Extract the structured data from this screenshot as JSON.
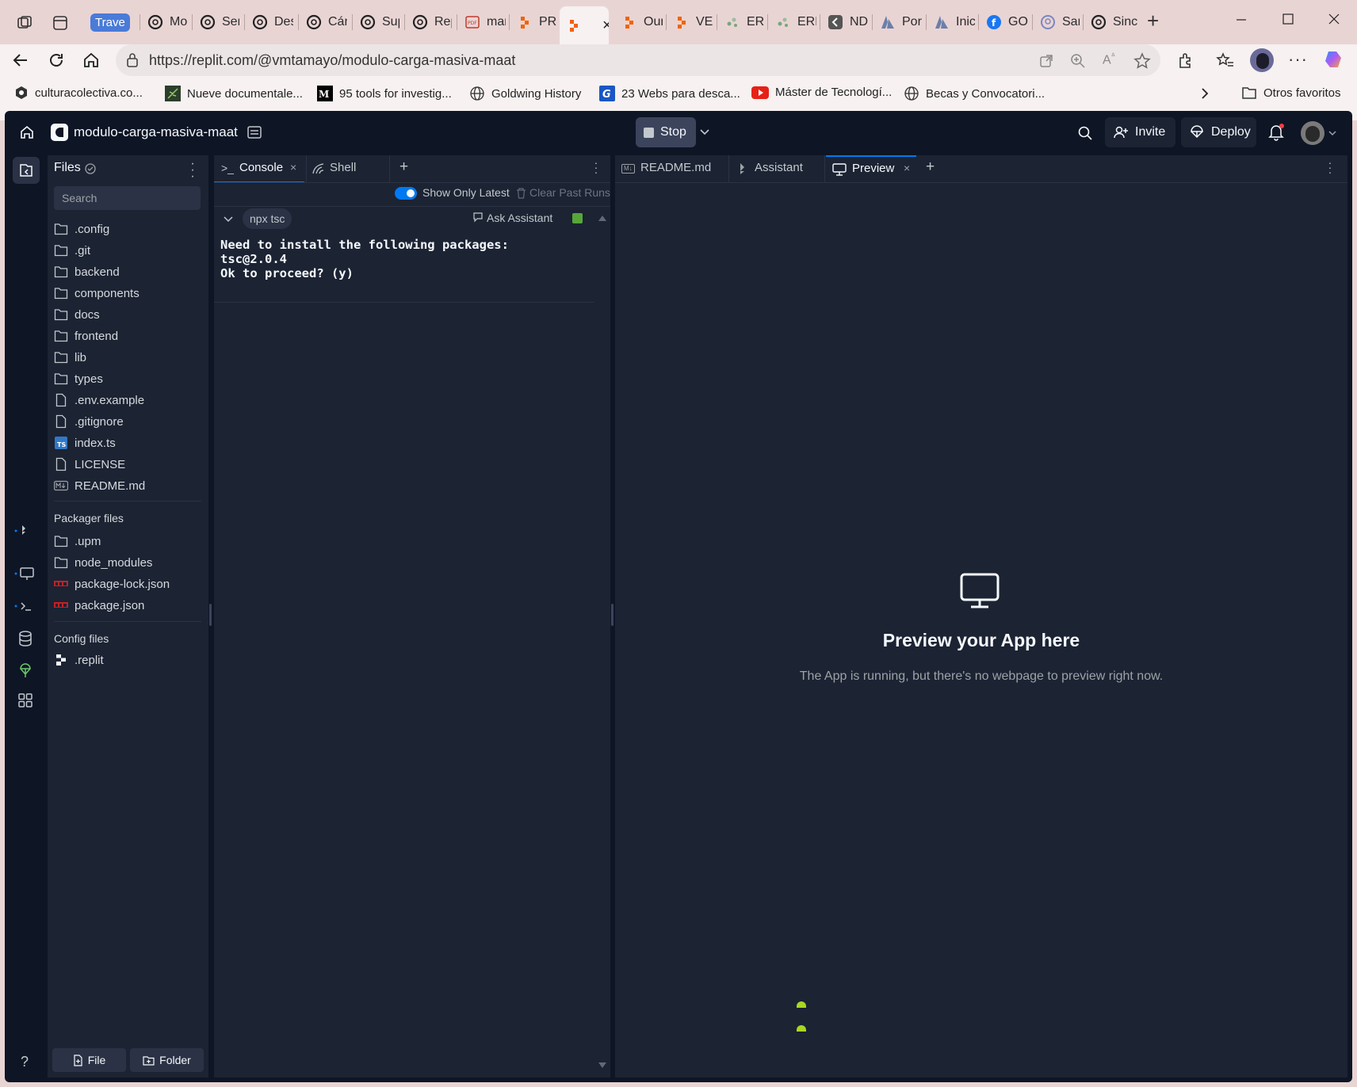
{
  "browser": {
    "tabs": [
      {
        "label": "Trave",
        "icon": "workspace-badge"
      },
      {
        "label": "Mo",
        "icon": "openai-icon"
      },
      {
        "label": "Ser",
        "icon": "openai-icon"
      },
      {
        "label": "Des",
        "icon": "openai-icon"
      },
      {
        "label": "Cán",
        "icon": "openai-icon"
      },
      {
        "label": "Sup",
        "icon": "openai-icon"
      },
      {
        "label": "Rep",
        "icon": "openai-icon"
      },
      {
        "label": "mar",
        "icon": "pdf-icon"
      },
      {
        "label": "PRO",
        "icon": "replit-icon"
      },
      {
        "label": "",
        "icon": "replit-icon"
      },
      {
        "label": "Our",
        "icon": "replit-icon"
      },
      {
        "label": "VES",
        "icon": "replit-icon"
      },
      {
        "label": "ERN",
        "icon": "dots-icon"
      },
      {
        "label": "ERN",
        "icon": "dots-icon"
      },
      {
        "label": "ND",
        "icon": "chevron-icon"
      },
      {
        "label": "Por",
        "icon": "azure-icon"
      },
      {
        "label": "Inic",
        "icon": "azure-icon"
      },
      {
        "label": "GO",
        "icon": "facebook-icon"
      },
      {
        "label": "San",
        "icon": "circle-icon"
      },
      {
        "label": "Sinc",
        "icon": "openai-icon"
      }
    ],
    "url": "https://replit.com/@vmtamayo/modulo-carga-masiva-maat",
    "bookmarks": [
      "culturacolectiva.co...",
      "Nueve documentale...",
      "95 tools for investig...",
      "Goldwing History",
      "23 Webs para desca...",
      "Máster de Tecnologí...",
      "Becas y Convocatori..."
    ],
    "other_favorites": "Otros favoritos"
  },
  "app": {
    "repl_name": "modulo-carga-masiva-maat",
    "stop_label": "Stop",
    "invite_label": "Invite",
    "deploy_label": "Deploy"
  },
  "files": {
    "title": "Files",
    "search_placeholder": "Search",
    "items": [
      {
        "name": ".config",
        "type": "folder"
      },
      {
        "name": ".git",
        "type": "folder"
      },
      {
        "name": "backend",
        "type": "folder"
      },
      {
        "name": "components",
        "type": "folder"
      },
      {
        "name": "docs",
        "type": "folder"
      },
      {
        "name": "frontend",
        "type": "folder"
      },
      {
        "name": "lib",
        "type": "folder"
      },
      {
        "name": "types",
        "type": "folder"
      },
      {
        "name": ".env.example",
        "type": "file"
      },
      {
        "name": ".gitignore",
        "type": "file"
      },
      {
        "name": "index.ts",
        "type": "ts"
      },
      {
        "name": "LICENSE",
        "type": "file"
      },
      {
        "name": "README.md",
        "type": "md"
      }
    ],
    "packager_title": "Packager files",
    "packager_items": [
      {
        "name": ".upm",
        "type": "folder"
      },
      {
        "name": "node_modules",
        "type": "folder"
      },
      {
        "name": "package-lock.json",
        "type": "npm"
      },
      {
        "name": "package.json",
        "type": "npm"
      }
    ],
    "config_title": "Config files",
    "config_items": [
      {
        "name": ".replit",
        "type": "replit"
      }
    ],
    "new_file_label": "File",
    "new_folder_label": "Folder"
  },
  "console": {
    "tab_console": "Console",
    "tab_shell": "Shell",
    "show_only_latest": "Show Only Latest",
    "clear_past_runs": "Clear Past Runs",
    "command": "npx tsc",
    "ask_assistant": "Ask Assistant",
    "output": [
      "Need to install the following packages:",
      "tsc@2.0.4",
      "Ok to proceed? (y)"
    ]
  },
  "preview": {
    "tab_readme": "README.md",
    "tab_assistant": "Assistant",
    "tab_preview": "Preview",
    "heading": "Preview your App here",
    "message": "The App is running, but there's no webpage to preview right now."
  },
  "colors": {
    "app_bg": "#0e1525",
    "panel_bg": "#1c2333",
    "accent_blue": "#0079f2",
    "run_green": "#58a63a"
  }
}
